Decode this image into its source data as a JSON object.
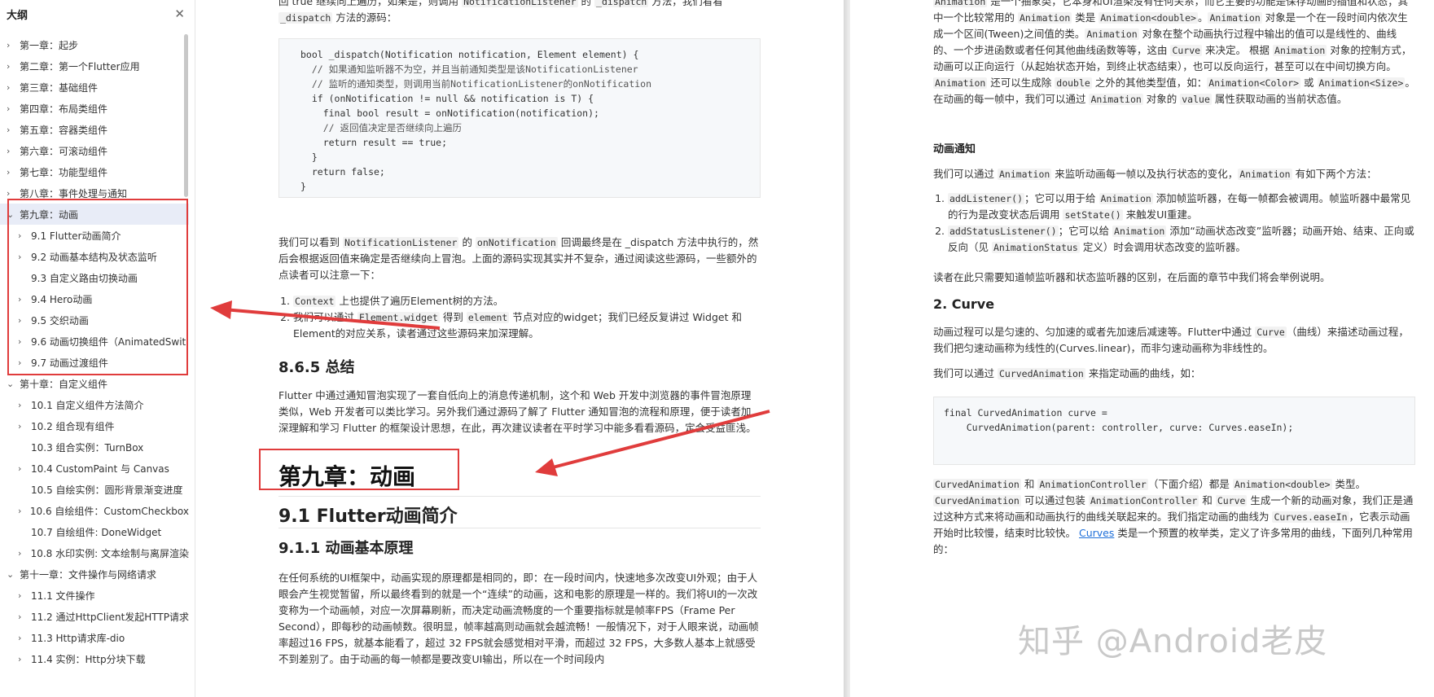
{
  "sidebar": {
    "title": "大纲",
    "close_icon": "close-icon",
    "items": [
      {
        "label": "第一章：起步",
        "level": 1,
        "arrow": "›"
      },
      {
        "label": "第二章：第一个Flutter应用",
        "level": 1,
        "arrow": "›"
      },
      {
        "label": "第三章：基础组件",
        "level": 1,
        "arrow": "›"
      },
      {
        "label": "第四章：布局类组件",
        "level": 1,
        "arrow": "›"
      },
      {
        "label": "第五章：容器类组件",
        "level": 1,
        "arrow": "›"
      },
      {
        "label": "第六章：可滚动组件",
        "level": 1,
        "arrow": "›"
      },
      {
        "label": "第七章：功能型组件",
        "level": 1,
        "arrow": "›"
      },
      {
        "label": "第八章：事件处理与通知",
        "level": 1,
        "arrow": "›"
      },
      {
        "label": "第九章：动画",
        "level": 1,
        "arrow": "⌄",
        "active": true
      },
      {
        "label": "9.1 Flutter动画简介",
        "level": 2,
        "arrow": "›"
      },
      {
        "label": "9.2 动画基本结构及状态监听",
        "level": 2,
        "arrow": "›"
      },
      {
        "label": "9.3 自定义路由切换动画",
        "level": 2,
        "arrow": ""
      },
      {
        "label": "9.4 Hero动画",
        "level": 2,
        "arrow": "›"
      },
      {
        "label": "9.5 交织动画",
        "level": 2,
        "arrow": "›"
      },
      {
        "label": "9.6 动画切换组件（AnimatedSwit",
        "level": 2,
        "arrow": "›"
      },
      {
        "label": "9.7 动画过渡组件",
        "level": 2,
        "arrow": "›"
      },
      {
        "label": "第十章：自定义组件",
        "level": 1,
        "arrow": "⌄"
      },
      {
        "label": "10.1 自定义组件方法简介",
        "level": 2,
        "arrow": "›"
      },
      {
        "label": "10.2 组合现有组件",
        "level": 2,
        "arrow": "›"
      },
      {
        "label": "10.3 组合实例：TurnBox",
        "level": 2,
        "arrow": ""
      },
      {
        "label": "10.4 CustomPaint 与 Canvas",
        "level": 2,
        "arrow": "›"
      },
      {
        "label": "10.5 自绘实例：圆形背景渐变进度",
        "level": 2,
        "arrow": ""
      },
      {
        "label": "10.6 自绘组件：CustomCheckbox",
        "level": 2,
        "arrow": "›"
      },
      {
        "label": "10.7 自绘组件: DoneWidget",
        "level": 2,
        "arrow": ""
      },
      {
        "label": "10.8 水印实例: 文本绘制与离屏渲染",
        "level": 2,
        "arrow": "›"
      },
      {
        "label": "第十一章：文件操作与网络请求",
        "level": 1,
        "arrow": "⌄"
      },
      {
        "label": "11.1 文件操作",
        "level": 2,
        "arrow": "›"
      },
      {
        "label": "11.2 通过HttpClient发起HTTP请求",
        "level": 2,
        "arrow": "›"
      },
      {
        "label": "11.3 Http请求库-dio",
        "level": 2,
        "arrow": "›"
      },
      {
        "label": "11.4 实例：Http分块下载",
        "level": 2,
        "arrow": "›"
      }
    ]
  },
  "mid": {
    "top_line_a": "回 true 继续向上遍历，如果是，则调用 ",
    "top_line_code1": "NotificationListener",
    "top_line_b": " 的 ",
    "top_line_code2": "_dispatch",
    "top_line_c": " 方法，我们看看",
    "top_line2_code": "_dispatch",
    "top_line2": " 方法的源码：",
    "code_lines": [
      "bool _dispatch(Notification notification, Element element) {",
      "  // 如果通知监听器不为空，并且当前通知类型是该NotificationListener",
      "  // 监听的通知类型，则调用当前NotificationListener的onNotification",
      "  if (onNotification != null && notification is T) {",
      "    final bool result = onNotification(notification);",
      "    // 返回值决定是否继续向上遍历",
      "    return result == true;",
      "  }",
      "  return false;",
      "}"
    ],
    "para1_a": "我们可以看到 ",
    "para1_code1": "NotificationListener",
    "para1_b": " 的 ",
    "para1_code2": "onNotification",
    "para1_c": " 回调最终是在 _dispatch 方法中执行的，然后会根据返回值来确定是否继续向上冒泡。上面的源码实现其实并不复杂，通过阅读这些源码，一些额外的点读者可以注意一下：",
    "list1_code": "Context",
    "list1": " 上也提供了遍历Element树的方法。",
    "list2_a": "我们可以通过 ",
    "list2_code1": "Element.widget",
    "list2_b": " 得到 ",
    "list2_code2": "element",
    "list2_c": " 节点对应的widget；我们已经反复讲过 Widget 和 Element的对应关系，读者通过这些源码来加深理解。",
    "h_summary": "8.6.5 总结",
    "para2": "Flutter 中通过通知冒泡实现了一套自低向上的消息传递机制，这个和 Web 开发中浏览器的事件冒泡原理类似，Web 开发者可以类比学习。另外我们通过源码了解了 Flutter 通知冒泡的流程和原理，便于读者加深理解和学习 Flutter 的框架设计思想，在此，再次建议读者在平时学习中能多看看源码，定会受益匪浅。",
    "h_chapter": "第九章：动画",
    "h_section": "9.1 Flutter动画简介",
    "h_sub": "9.1.1 动画基本原理",
    "para3": "在任何系统的UI框架中，动画实现的原理都是相同的，即：在一段时间内，快速地多次改变UI外观；由于人眼会产生视觉暂留，所以最终看到的就是一个“连续”的动画，这和电影的原理是一样的。我们将UI的一次改变称为一个动画帧，对应一次屏幕刷新，而决定动画流畅度的一个重要指标就是帧率FPS（Frame Per Second），即每秒的动画帧数。很明显，帧率越高则动画就会越流畅！一般情况下，对于人眼来说，动画帧率超过16 FPS，就基本能看了，超过 32 FPS就会感觉相对平滑，而超过 32 FPS，大多数人基本上就感受不到差别了。由于动画的每一帧都是要改变UI输出，所以在一个时间段内"
  },
  "right": {
    "p1_code1": "Animation",
    "p1_a": " 是一个抽象类，它本身和UI渲染没有任何关系，而它主要的功能是保存动画的插值和状态；其中一个比较常用的 ",
    "p1_code2": "Animation",
    "p1_b": " 类是 ",
    "p1_code3": "Animation<double>",
    "p1_c": "。",
    "p1_code4": "Animation",
    "p1_d": " 对象是一个在一段时间内依次生成一个区间(Tween)之间值的类。",
    "p1_code5": "Animation",
    "p1_e": " 对象在整个动画执行过程中输出的值可以是线性的、曲线的、一个步进函数或者任何其他曲线函数等等，这由 ",
    "p1_code6": "Curve",
    "p1_f": " 来决定。 根据 ",
    "p1_code7": "Animation",
    "p1_g": " 对象的控制方式，动画可以正向运行（从起始状态开始，到终止状态结束），也可以反向运行，甚至可以在中间切换方向。",
    "p1_code8": "Animation",
    "p1_h": " 还可以生成除 ",
    "p1_code9": "double",
    "p1_i": " 之外的其他类型值，如：",
    "p1_code10": "Animation<Color>",
    "p1_j": " 或 ",
    "p1_code11": "Animation<Size>",
    "p1_k": "。在动画的每一帧中，我们可以通过 ",
    "p1_code12": "Animation",
    "p1_l": " 对象的 ",
    "p1_code13": "value",
    "p1_m": " 属性获取动画的当前状态值。",
    "h_notify": "动画通知",
    "p2_a": "我们可以通过 ",
    "p2_code1": "Animation",
    "p2_b": " 来监听动画每一帧以及执行状态的变化，",
    "p2_code2": "Animation",
    "p2_c": " 有如下两个方法：",
    "li1_code1": "addListener()",
    "li1_a": "；它可以用于给 ",
    "li1_code2": "Animation",
    "li1_b": " 添加帧监听器，在每一帧都会被调用。帧监听器中最常见的行为是改变状态后调用 ",
    "li1_code3": "setState()",
    "li1_c": " 来触发UI重建。",
    "li2_code1": "addStatusListener()",
    "li2_a": "；它可以给 ",
    "li2_code2": "Animation",
    "li2_b": " 添加“动画状态改变”监听器；动画开始、结束、正向或反向（见 ",
    "li2_code3": "AnimationStatus",
    "li2_c": " 定义）时会调用状态改变的监听器。",
    "p3": "读者在此只需要知道帧监听器和状态监听器的区别，在后面的章节中我们将会举例说明。",
    "h_curve": "2. Curve",
    "p4_a": "动画过程可以是匀速的、匀加速的或者先加速后减速等。Flutter中通过 ",
    "p4_code": "Curve",
    "p4_b": "（曲线）来描述动画过程，我们把匀速动画称为线性的(Curves.linear)，而非匀速动画称为非线性的。",
    "p5_a": "我们可以通过 ",
    "p5_code": "CurvedAnimation",
    "p5_b": " 来指定动画的曲线，如：",
    "code_lines": [
      "final CurvedAnimation curve =",
      "    CurvedAnimation(parent: controller, curve: Curves.easeIn);"
    ],
    "p6_code1": "CurvedAnimation",
    "p6_a": " 和 ",
    "p6_code2": "AnimationController",
    "p6_b": "（下面介绍）都是 ",
    "p6_code3": "Animation<double>",
    "p6_c": " 类型。",
    "p6_code4": "CurvedAnimation",
    "p6_d": " 可以通过包装 ",
    "p6_code5": "AnimationController",
    "p6_e": " 和 ",
    "p6_code6": "Curve",
    "p6_f": " 生成一个新的动画对象，我们正是通过这种方式来将动画和动画执行的曲线关联起来的。我们指定动画的曲线为 ",
    "p6_code7": "Curves.easeIn",
    "p6_g": "，它表示动画开始时比较慢，结束时比较快。 ",
    "p6_link": "Curves",
    "p6_h": " 类是一个预置的枚举类，定义了许多常用的曲线，下面列几种常用的："
  },
  "watermark": "知乎 @Android老皮",
  "colors": {
    "annotation_red": "#e03c3c",
    "link": "#1e6fd9"
  }
}
